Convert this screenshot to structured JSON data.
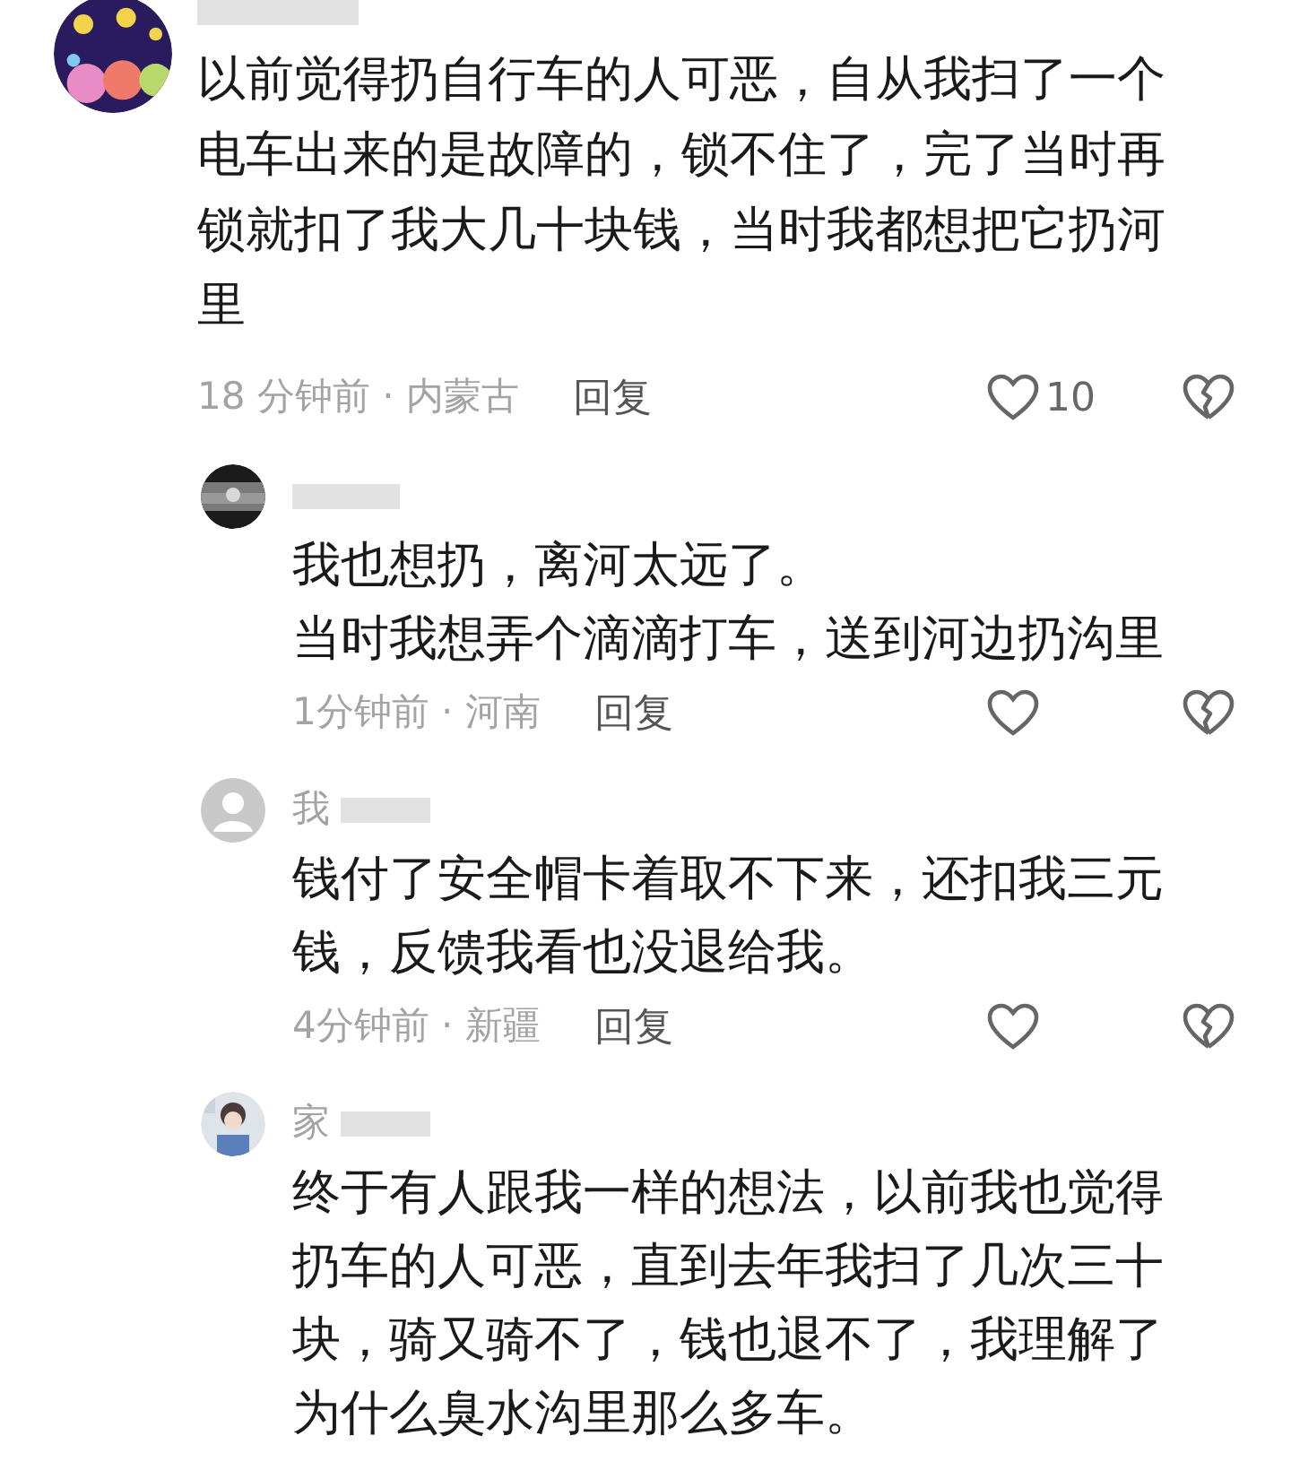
{
  "comment": {
    "text": "以前觉得扔自行车的人可恶，自从我扫了一个电车出来的是故障的，锁不住了，完了当时再锁就扣了我大几十块钱，当时我都想把它扔河里",
    "time_location": "18 分钟前 · 内蒙古",
    "reply_label": "回复",
    "likes": "10",
    "replies": [
      {
        "lines": [
          "我也想扔，离河太远了。",
          "当时我想弄个滴滴打车，送到河边扔沟里"
        ],
        "time_location": "1分钟前 · 河南",
        "reply_label": "回复",
        "avatar": {
          "kind": "picture"
        }
      },
      {
        "author": "我",
        "text": "钱付了安全帽卡着取不下来，还扣我三元钱，反馈我看也没退给我。",
        "time_location": "4分钟前 · 新疆",
        "reply_label": "回复",
        "avatar": {
          "kind": "default"
        }
      },
      {
        "author": "家",
        "text": "终于有人跟我一样的想法，以前我也觉得扔车的人可恶，直到去年我扫了几次三十块，骑又骑不了，钱也退不了，我理解了为什么臭水沟里那么多车。",
        "avatar": {
          "kind": "picture"
        }
      }
    ]
  }
}
